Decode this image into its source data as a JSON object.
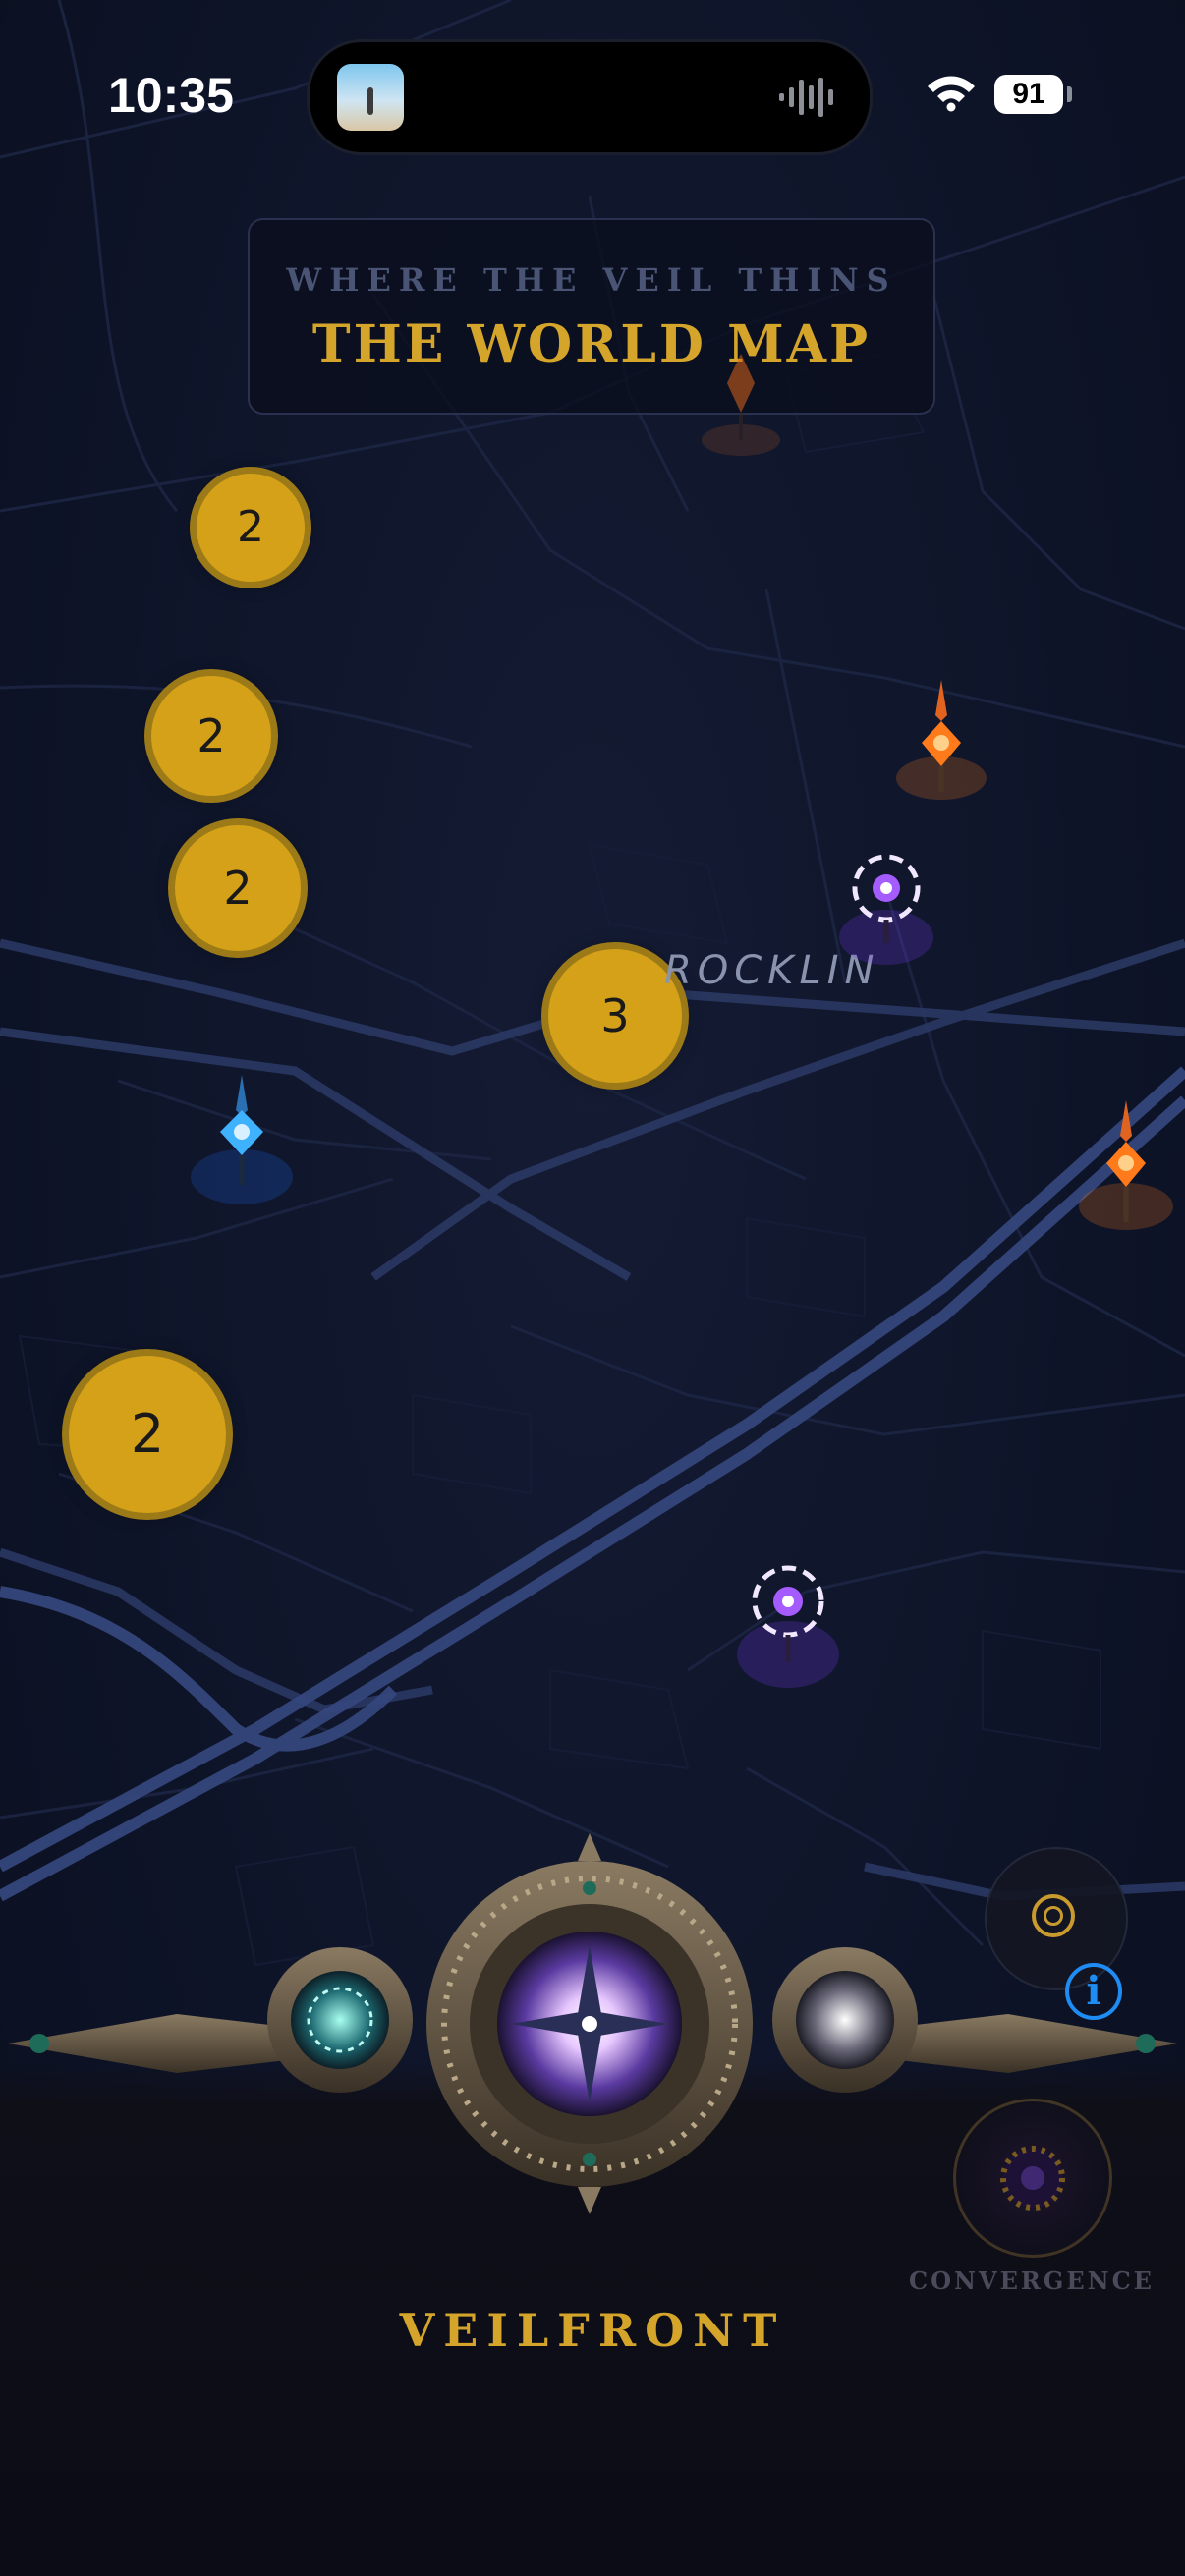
{
  "status_bar": {
    "time": "10:35",
    "battery": "91",
    "icons": [
      "wifi-icon",
      "battery-icon",
      "waveform-icon"
    ]
  },
  "banner": {
    "subtitle": "WHERE THE VEIL THINS",
    "title": "THE WORLD MAP"
  },
  "map": {
    "place_label": "ROCKLIN",
    "clusters": [
      {
        "count": "2"
      },
      {
        "count": "2"
      },
      {
        "count": "2"
      },
      {
        "count": "3"
      },
      {
        "count": "2"
      }
    ],
    "pins": [
      {
        "type": "orange-crystal-pin",
        "color": "#ff7a1a"
      },
      {
        "type": "orange-crystal-pin",
        "color": "#ff7a1a"
      },
      {
        "type": "orange-crystal-pin",
        "color": "#ff7a1a"
      },
      {
        "type": "purple-portal-pin",
        "color": "#a55cff"
      },
      {
        "type": "purple-portal-pin",
        "color": "#a55cff"
      },
      {
        "type": "blue-crystal-pin",
        "color": "#3fb2ff"
      }
    ]
  },
  "dock": {
    "label": "VEILFRONT",
    "convergence_label": "CONVERGENCE",
    "info_glyph": "i"
  },
  "colors": {
    "accent_gold": "#d4a52a",
    "cluster_fill": "#d4a118",
    "map_bg": "#0e1428",
    "road": "#2c3a66",
    "info_blue": "#1e8cf2"
  }
}
